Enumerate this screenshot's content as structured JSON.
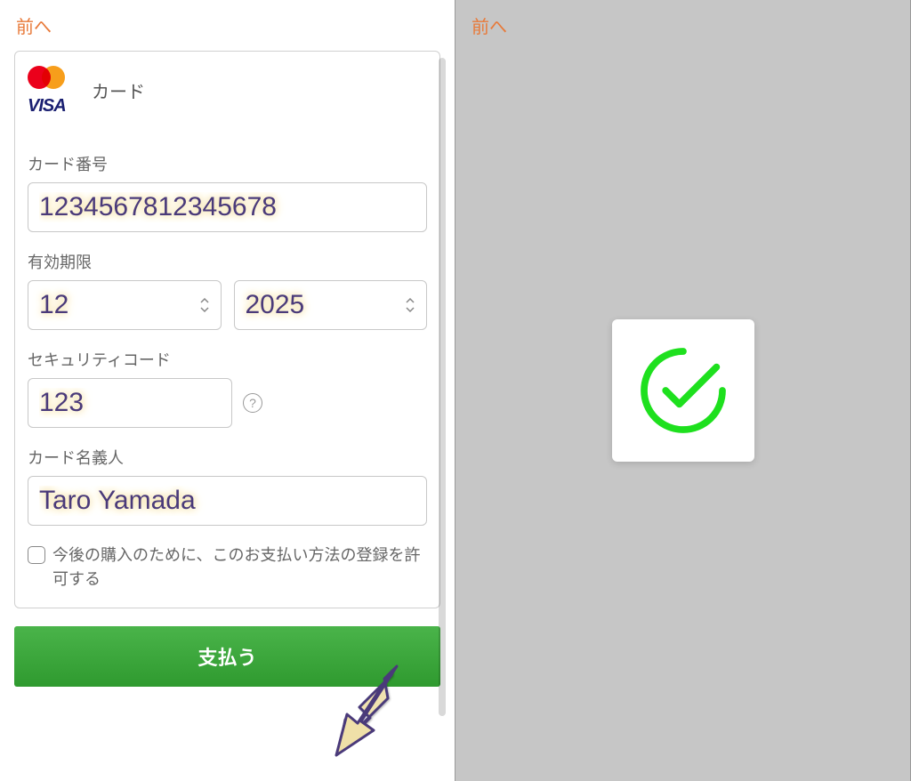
{
  "nav": {
    "back_label": "前へ"
  },
  "card_section": {
    "brand_label": "カード",
    "visa_text": "VISA"
  },
  "fields": {
    "card_number": {
      "label": "カード番号",
      "value": "1234567812345678"
    },
    "expiry": {
      "label": "有効期限",
      "month": "12",
      "year": "2025"
    },
    "cvv": {
      "label": "セキュリティコード",
      "value": "123"
    },
    "holder": {
      "label": "カード名義人",
      "value": "Taro Yamada"
    },
    "save_checkbox": {
      "label": "今後の購入のために、このお支払い方法の登録を許可する",
      "checked": false
    }
  },
  "actions": {
    "pay_label": "支払う"
  },
  "help": {
    "question_mark": "?"
  },
  "colors": {
    "accent": "#e87a3a",
    "pay_button": "#3aa23a",
    "input_text": "#4a3a7a",
    "success_green": "#1ee01e"
  }
}
